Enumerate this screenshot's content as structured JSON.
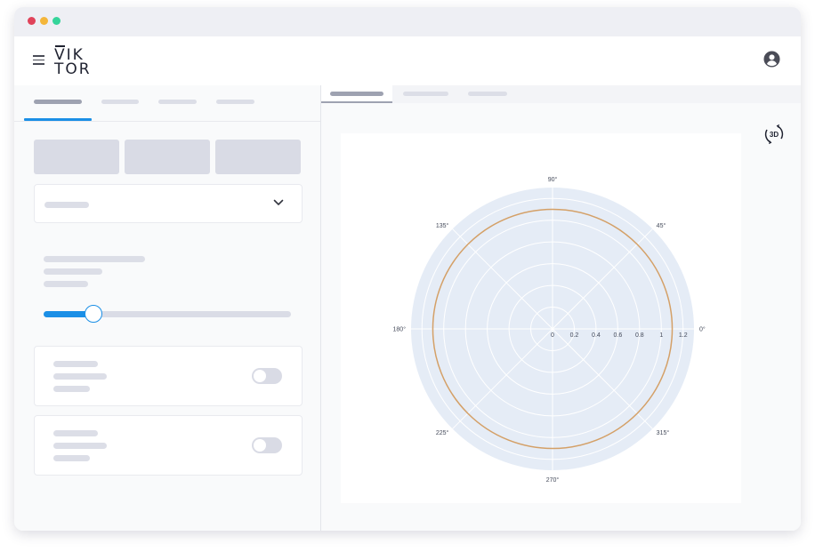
{
  "window": {
    "traffic_lights": [
      {
        "name": "close",
        "color": "#e0435a"
      },
      {
        "name": "minimize",
        "color": "#f4b63a"
      },
      {
        "name": "maximize",
        "color": "#35d49a"
      }
    ]
  },
  "header": {
    "menu_icon": "hamburger-menu-icon",
    "logo": {
      "line1": "VIK",
      "line2": "TOR"
    },
    "user_icon": "user-circle-icon"
  },
  "left_panel": {
    "tabs_active_index": 0,
    "toggles": [
      {
        "on": false
      },
      {
        "on": false
      }
    ],
    "slider": {
      "value_fraction": 0.2
    },
    "dropdown_icon": "chevron-down-icon"
  },
  "view_panel": {
    "tabs_active_index": 0,
    "view_3d_label": "3D"
  },
  "colors": {
    "accent": "#1b8fe6",
    "plot_bg": "#e5ecf6",
    "trace": "#d4a067",
    "placeholder": "#dcdee7"
  },
  "chart_data": {
    "type": "polar",
    "radial_axis": {
      "range": [
        0,
        1.3
      ],
      "tick_values": [
        0,
        0.2,
        0.4,
        0.6,
        0.8,
        1,
        1.2
      ],
      "tick_labels": [
        "0",
        "0.2",
        "0.4",
        "0.6",
        "0.8",
        "1",
        "1.2"
      ]
    },
    "angular_axis": {
      "tick_values": [
        0,
        45,
        90,
        135,
        180,
        225,
        270,
        315
      ],
      "tick_labels": [
        "0°",
        "45°",
        "90°",
        "135°",
        "180°",
        "225°",
        "270°",
        "315°"
      ]
    },
    "series": [
      {
        "mode": "line",
        "r": 1.1,
        "theta_range": [
          0,
          360
        ],
        "color": "#d4a067"
      }
    ]
  }
}
